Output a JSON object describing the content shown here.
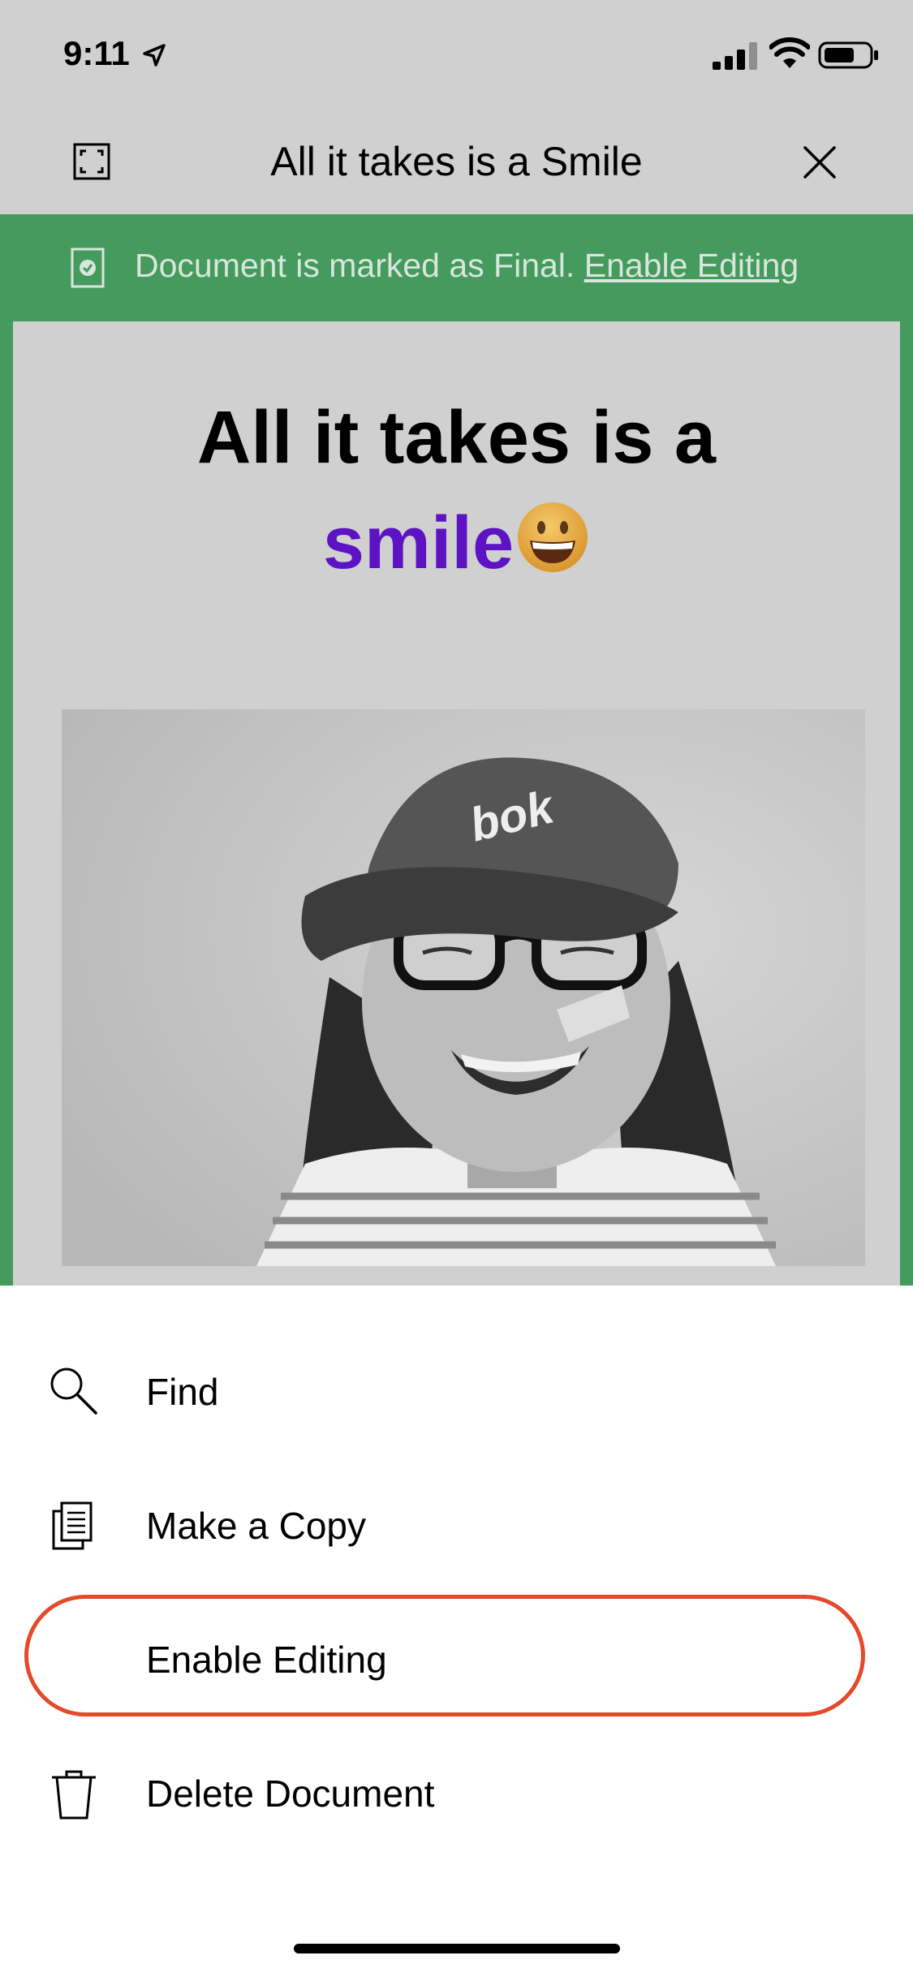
{
  "status_bar": {
    "time": "9:11",
    "location_icon": "location-arrow-icon",
    "signal_icon": "cellular-signal-icon",
    "wifi_icon": "wifi-icon",
    "battery_icon": "battery-icon"
  },
  "navbar": {
    "title": "All it takes is a Smile",
    "expand_icon": "expand-icon",
    "close_icon": "close-icon"
  },
  "final_banner": {
    "message": "Document is marked as Final.",
    "link": "Enable Editing",
    "icon": "document-check-icon",
    "color": "#459a5e"
  },
  "document": {
    "title_line1": "All it takes is a",
    "title_accent": "smile",
    "title_emoji": "grinning-face-emoji",
    "accent_color": "#5d13c4",
    "photo": "grayscale-photo-smiling-girl-with-cap-and-glasses"
  },
  "action_sheet": {
    "items": [
      {
        "label": "Find",
        "icon": "search-icon"
      },
      {
        "label": "Make a Copy",
        "icon": "copy-icon"
      },
      {
        "label": "Enable Editing",
        "icon": ""
      },
      {
        "label": "Delete Document",
        "icon": "trash-icon"
      }
    ],
    "highlight_color": "#e4492a"
  }
}
